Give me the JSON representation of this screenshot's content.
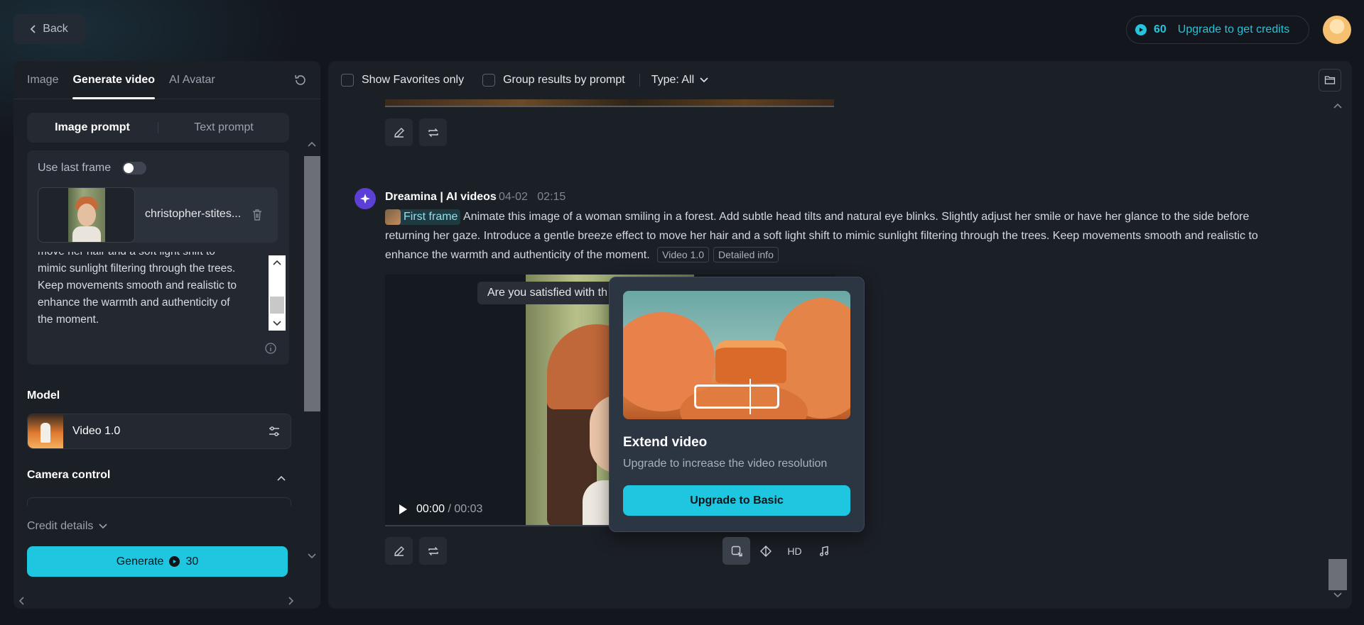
{
  "header": {
    "back_label": "Back",
    "credits": "60",
    "upgrade_label": "Upgrade to get credits"
  },
  "left": {
    "tabs": [
      {
        "label": "Image"
      },
      {
        "label": "Generate video"
      },
      {
        "label": "AI Avatar"
      }
    ],
    "prompt_modes": {
      "image": "Image prompt",
      "text": "Text prompt"
    },
    "use_last_frame_label": "Use last frame",
    "file_name": "christopher-stites...",
    "prompt_lines": [
      "move her hair and a soft light shift to",
      "mimic sunlight filtering through the trees.",
      "Keep movements smooth and realistic to",
      "enhance the warmth and authenticity of",
      "the moment."
    ],
    "model_section_label": "Model",
    "model_name": "Video 1.0",
    "camera_section_label": "Camera control",
    "credit_details_label": "Credit details",
    "generate_label": "Generate",
    "generate_cost": "30"
  },
  "main": {
    "filters": {
      "favorites_label": "Show Favorites only",
      "group_label": "Group results by prompt",
      "type_label": "Type: All"
    },
    "post": {
      "author": "Dreamina | AI videos",
      "date": "04-02",
      "time": "02:15",
      "first_frame_label": "First frame",
      "prompt": "Animate this image of a woman smiling in a forest. Add subtle head tilts and natural eye blinks. Slightly adjust her smile or have her glance to the side before returning her gaze. Introduce a gentle breeze effect to move her hair and a soft light shift to mimic sunlight filtering through the trees. Keep movements smooth and realistic to enhance the warmth and authenticity of the moment.",
      "model_tag": "Video 1.0",
      "detail_tag": "Detailed info"
    },
    "video": {
      "satisfied_text": "Are you satisfied with th",
      "current_time": "00:00",
      "duration": "00:03"
    },
    "popover": {
      "title": "Extend video",
      "description": "Upgrade to increase the video resolution",
      "button_label": "Upgrade to Basic"
    },
    "tools": {
      "hd_label": "HD"
    }
  },
  "colors": {
    "accent": "#1fc6df",
    "background": "#13161c",
    "panel": "#1b1f26"
  }
}
